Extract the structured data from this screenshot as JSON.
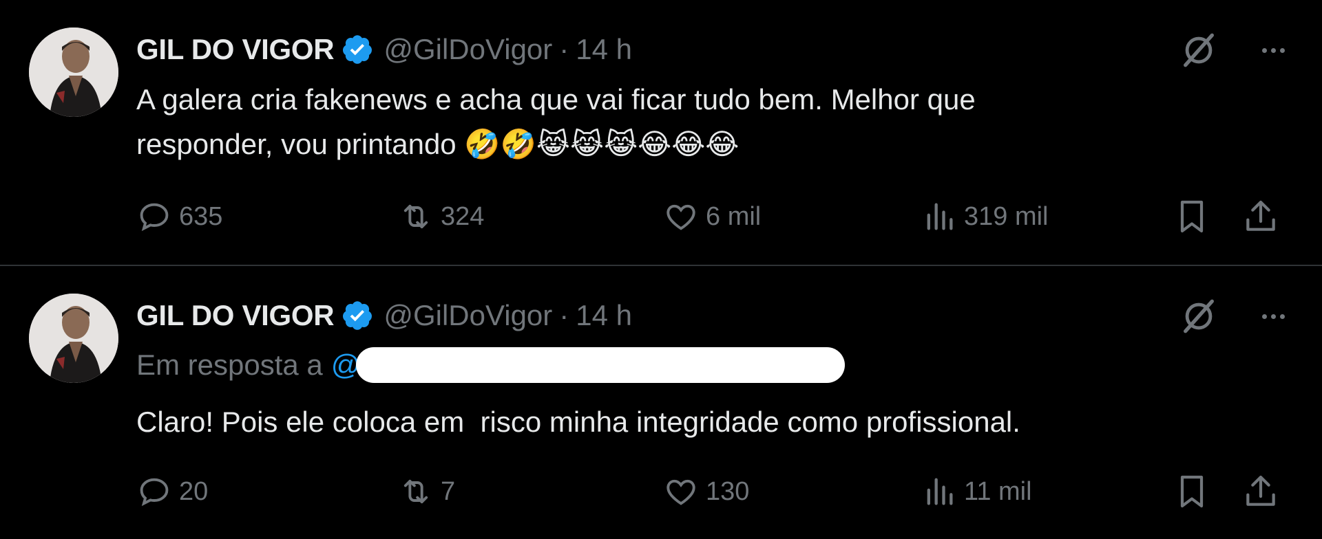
{
  "colors": {
    "background": "#000000",
    "text": "#e7e9ea",
    "muted": "#71767b",
    "accent": "#1d9bf0",
    "verified": "#1d9bf0"
  },
  "tweets": [
    {
      "author_name": "GIL DO VIGOR",
      "handle": "@GilDoVigor",
      "separator": "·",
      "time": "14 h",
      "text": "A galera cria fakenews e acha que vai ficar tudo bem. Melhor que\nresponder, vou printando 🤣🤣😹😹😹😂😂😂",
      "replies": "635",
      "retweets": "324",
      "likes": "6 mil",
      "views": "319 mil"
    },
    {
      "author_name": "GIL DO VIGOR",
      "handle": "@GilDoVigor",
      "separator": "·",
      "time": "14 h",
      "reply_prefix": "Em resposta a",
      "reply_mention": "@",
      "text": "Claro! Pois ele coloca em  risco minha integridade como profissional.",
      "replies": "20",
      "retweets": "7",
      "likes": "130",
      "views": "11 mil"
    }
  ],
  "icons": {
    "verified": "verified-badge-icon",
    "grok": "grok-icon",
    "more": "more-icon",
    "reply": "reply-icon",
    "retweet": "retweet-icon",
    "like": "heart-icon",
    "views": "views-icon",
    "bookmark": "bookmark-icon",
    "share": "share-icon"
  }
}
